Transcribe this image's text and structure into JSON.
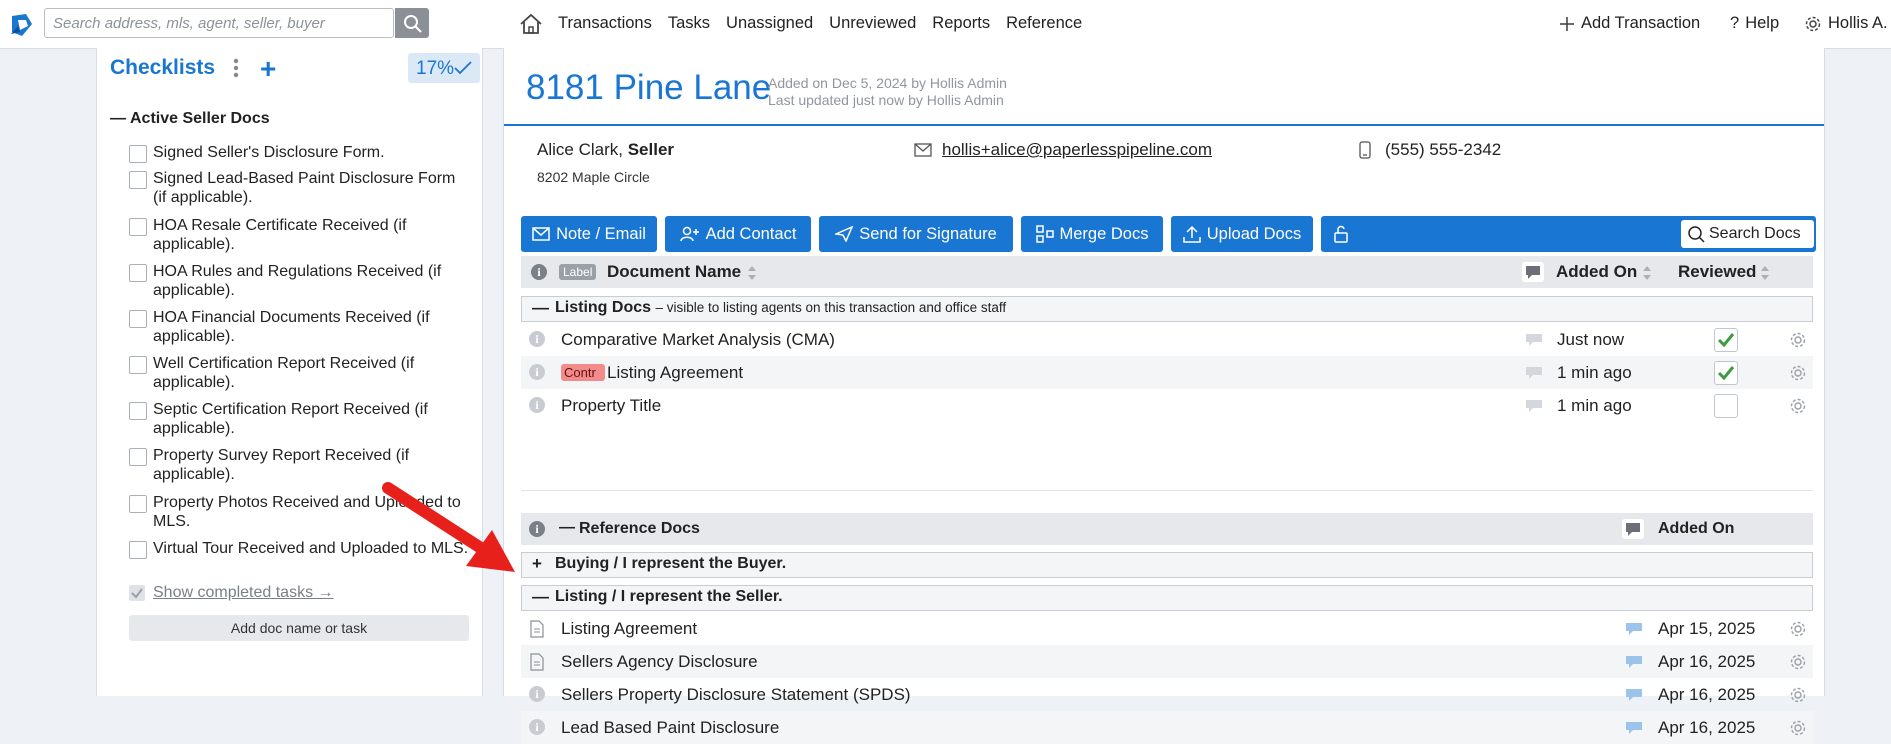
{
  "search": {
    "placeholder": "Search address, mls, agent, seller, buyer"
  },
  "nav": {
    "items": [
      "Transactions",
      "Tasks",
      "Unassigned",
      "Unreviewed",
      "Reports",
      "Reference"
    ],
    "add_transaction": "Add Transaction",
    "help": "Help",
    "user": "Hollis A."
  },
  "checklists": {
    "title": "Checklists",
    "percent": "17%",
    "section": "Active Seller Docs",
    "tasks": [
      "Signed Seller's Disclosure Form.",
      "Signed Lead-Based Paint Disclosure Form (if applicable).",
      "HOA Resale Certificate Received (if applicable).",
      "HOA Rules and Regulations Received (if applicable).",
      "HOA Financial Documents Received (if applicable).",
      "Well Certification Report Received (if applicable).",
      "Septic Certification Report Received (if applicable).",
      "Property Survey Report Received (if applicable).",
      "Property Photos Received and Uploaded to MLS.",
      "Virtual Tour Received and Uploaded to MLS."
    ],
    "show_completed": "Show completed tasks →",
    "add_doc": "Add doc name or task"
  },
  "transaction": {
    "address": "8181 Pine Lane",
    "added_on": "Added on Dec 5, 2024 by Hollis Admin",
    "last_updated": "Last updated just now by Hollis Admin",
    "contact_name": "Alice Clark,",
    "contact_role": "Seller",
    "contact_address": "8202 Maple Circle",
    "email": "hollis+alice@paperlesspipeline.com",
    "phone": "(555) 555-2342"
  },
  "toolbar": {
    "note_email": "Note / Email",
    "add_contact": "Add Contact",
    "send_signature": "Send for Signature",
    "merge_docs": "Merge Docs",
    "upload_docs": "Upload Docs",
    "search_docs": "Search Docs"
  },
  "table": {
    "label_chip": "Label",
    "doc_name": "Document Name",
    "added_on": "Added On",
    "reviewed": "Reviewed"
  },
  "listing_docs": {
    "title": "Listing Docs",
    "subtitle": "– visible to listing agents on this transaction and office staff",
    "rows": [
      {
        "name": "Comparative Market Analysis (CMA)",
        "added": "Just now",
        "reviewed": true
      },
      {
        "tag": "Contr",
        "name": "Listing Agreement",
        "added": "1 min ago",
        "reviewed": true
      },
      {
        "name": "Property Title",
        "added": "1 min ago",
        "reviewed": false
      }
    ]
  },
  "reference_docs": {
    "title": "Reference Docs",
    "added_on": "Added On",
    "buying": "Buying / I represent the Buyer.",
    "listing": "Listing / I represent the Seller.",
    "rows": [
      {
        "name": "Listing Agreement",
        "added": "Apr 15, 2025",
        "icon": "doc"
      },
      {
        "name": "Sellers Agency Disclosure",
        "added": "Apr 16, 2025",
        "icon": "doc"
      },
      {
        "name": "Sellers Property Disclosure Statement (SPDS)",
        "added": "Apr 16, 2025",
        "icon": "info"
      },
      {
        "name": "Lead Based Paint Disclosure",
        "added": "Apr 16, 2025",
        "icon": "info"
      }
    ]
  },
  "colors": {
    "brand": "#1976d2",
    "arrow": "#e8201c",
    "tag": "#f28b8b",
    "check": "#3f9b3f"
  }
}
